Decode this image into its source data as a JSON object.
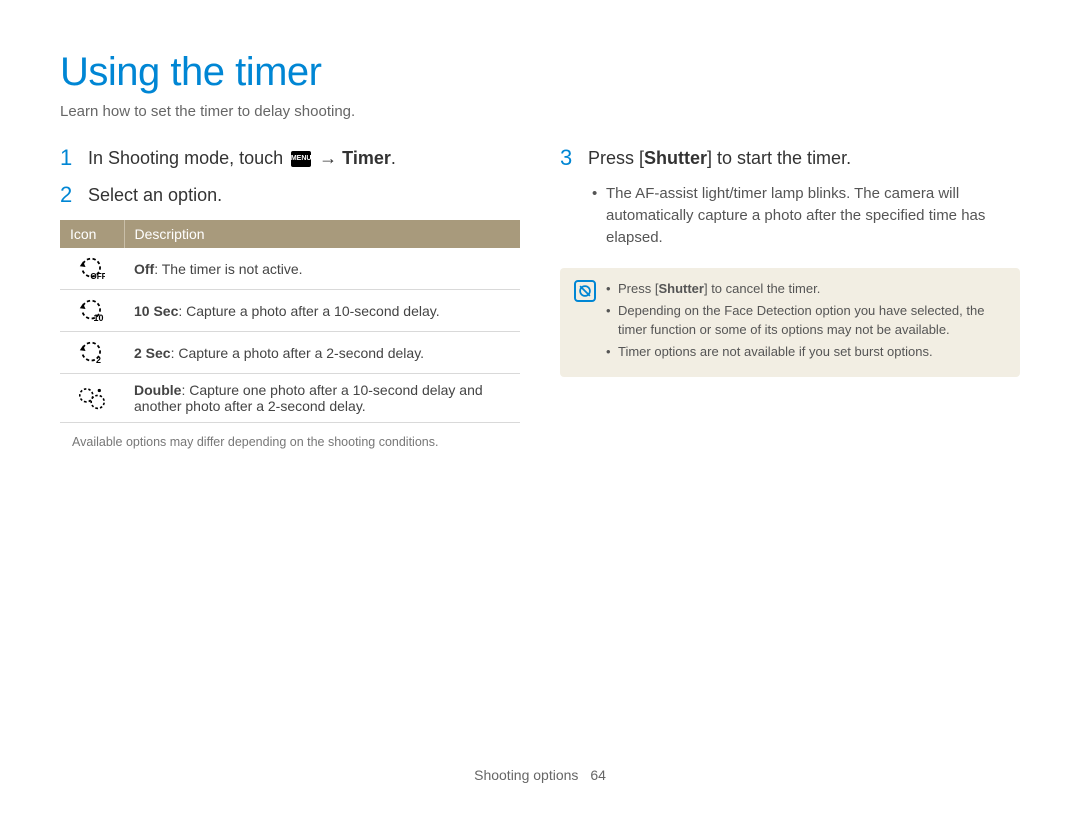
{
  "title": "Using the timer",
  "subtitle": "Learn how to set the timer to delay shooting.",
  "steps": {
    "s1_num": "1",
    "s1_a": "In Shooting mode, touch ",
    "s1_menu": "MENU",
    "s1_arrow": " → ",
    "s1_b": "Timer",
    "s1_c": ".",
    "s2_num": "2",
    "s2_text": "Select an option.",
    "s3_num": "3",
    "s3_a": "Press [",
    "s3_b": "Shutter",
    "s3_c": "] to start the timer."
  },
  "table": {
    "header_icon": "Icon",
    "header_desc": "Description",
    "rows": [
      {
        "icon": "timer-off-icon",
        "bold": "Off",
        "rest": ": The timer is not active."
      },
      {
        "icon": "timer-10-icon",
        "bold": "10 Sec",
        "rest": ": Capture a photo after a 10-second delay."
      },
      {
        "icon": "timer-2-icon",
        "bold": "2 Sec",
        "rest": ": Capture a photo after a 2-second delay."
      },
      {
        "icon": "timer-double-icon",
        "bold": "Double",
        "rest": ": Capture one photo after a 10-second delay and another photo after a 2-second delay."
      }
    ]
  },
  "footnote": "Available options may differ depending on the shooting conditions.",
  "step3_bullet": "The AF-assist light/timer lamp blinks. The camera will automatically capture a photo after the specified time has elapsed.",
  "note": {
    "n1_a": "Press [",
    "n1_b": "Shutter",
    "n1_c": "] to cancel the timer.",
    "n2": "Depending on the Face Detection option you have selected, the timer function or some of its options may not be available.",
    "n3": "Timer options are not available if you set burst options."
  },
  "footer": {
    "section": "Shooting options",
    "page": "64"
  }
}
